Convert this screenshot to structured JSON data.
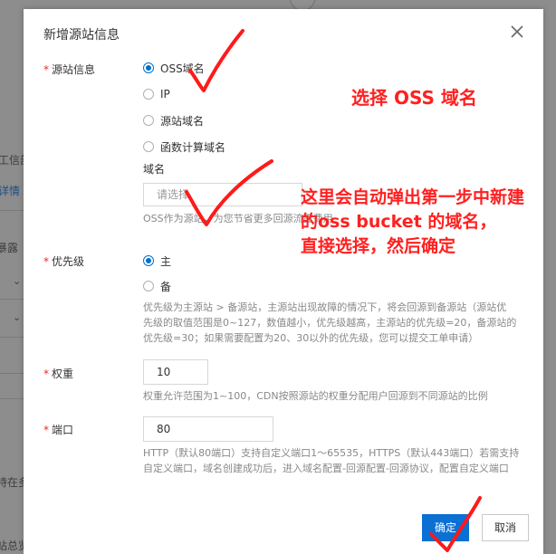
{
  "background": {
    "fragments": [
      "工信部",
      "详情",
      "暴露",
      "持在多",
      "站总览"
    ]
  },
  "dialog": {
    "title": "新增源站信息",
    "origin": {
      "label": "源站信息",
      "options": [
        "OSS域名",
        "IP",
        "源站域名",
        "函数计算域名"
      ],
      "selected_index": 0,
      "domain_label": "域名",
      "select_placeholder": "请选择",
      "help": "OSS作为源站，为您节省更多回源流量费用"
    },
    "priority": {
      "label": "优先级",
      "options": [
        "主",
        "备"
      ],
      "selected_index": 0,
      "help_lines": [
        "优先级为主源站 > 备源站，主源站出现故障的情况下，将会回源到备源站（源站优",
        "先级的取值范围是0~127，数值越小，优先级越高，主源站的优先级=20，备源站的",
        "优先级=30；如果需要配置为20、30以外的优先级，您可以提交工单申请）"
      ]
    },
    "weight": {
      "label": "权重",
      "value": "10",
      "help": "权重允许范围为1~100，CDN按照源站的权重分配用户回源到不同源站的比例"
    },
    "port": {
      "label": "端口",
      "value": "80",
      "help_lines": [
        "HTTP（默认80端口）支持自定义端口1～65535，HTTPS（默认443端口）若需支持",
        "自定义端口，域名创建成功后，进入域名配置-回源配置-回源协议，配置自定义端口"
      ]
    },
    "buttons": {
      "confirm": "确定",
      "cancel": "取消"
    }
  },
  "annotations": {
    "choose_oss": "选择 OSS 域名",
    "auto_popup_lines": [
      "这里会自动弹出第一步中新建",
      "的oss  bucket 的域名，",
      "直接选择，然后确定"
    ]
  },
  "colors": {
    "primary": "#0a70d4",
    "required": "#e0311f",
    "annotation": "#ff2020"
  }
}
